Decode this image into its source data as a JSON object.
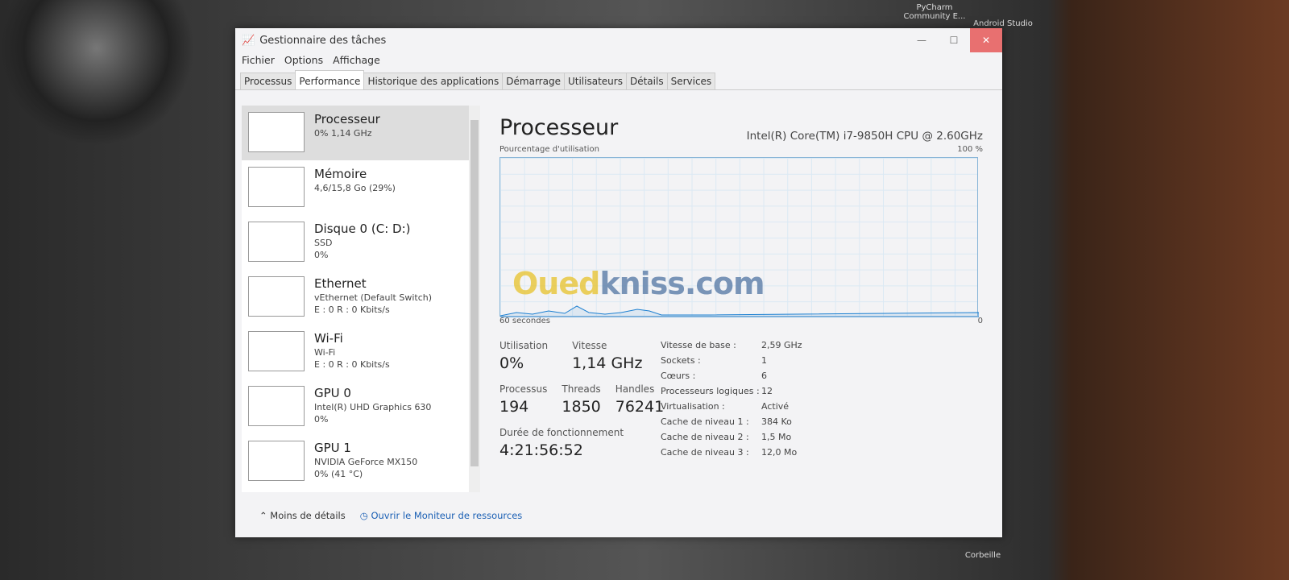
{
  "desktop": {
    "icons": [
      "PyCharm Community E...",
      "Android Studio",
      "Corbeille"
    ]
  },
  "window": {
    "title": "Gestionnaire des tâches",
    "controls": [
      "minimize",
      "maximize",
      "close"
    ]
  },
  "menu": [
    "Fichier",
    "Options",
    "Affichage"
  ],
  "tabs": [
    "Processus",
    "Performance",
    "Historique des applications",
    "Démarrage",
    "Utilisateurs",
    "Détails",
    "Services"
  ],
  "active_tab": "Performance",
  "sidebar": [
    {
      "name": "Processeur",
      "sub1": "0% 1,14 GHz",
      "sub2": ""
    },
    {
      "name": "Mémoire",
      "sub1": "4,6/15,8 Go (29%)",
      "sub2": ""
    },
    {
      "name": "Disque 0 (C: D:)",
      "sub1": "SSD",
      "sub2": "0%"
    },
    {
      "name": "Ethernet",
      "sub1": "vEthernet (Default Switch)",
      "sub2": "E : 0 R : 0 Kbits/s"
    },
    {
      "name": "Wi-Fi",
      "sub1": "Wi-Fi",
      "sub2": "E : 0 R : 0 Kbits/s"
    },
    {
      "name": "GPU 0",
      "sub1": "Intel(R) UHD Graphics 630",
      "sub2": "0%"
    },
    {
      "name": "GPU 1",
      "sub1": "NVIDIA GeForce MX150",
      "sub2": "0% (41 °C)"
    }
  ],
  "main": {
    "title": "Processeur",
    "model": "Intel(R) Core(TM) i7-9850H CPU @ 2.60GHz",
    "graph_label": "Pourcentage d'utilisation",
    "graph_max": "100 %",
    "graph_min": "0",
    "graph_time": "60 secondes",
    "utilisation_label": "Utilisation",
    "utilisation": "0%",
    "vitesse_label": "Vitesse",
    "vitesse": "1,14 GHz",
    "processus_label": "Processus",
    "processus": "194",
    "threads_label": "Threads",
    "threads": "1850",
    "handles_label": "Handles",
    "handles": "76241",
    "uptime_label": "Durée de fonctionnement",
    "uptime": "4:21:56:52",
    "specs": [
      [
        "Vitesse de base :",
        "2,59 GHz"
      ],
      [
        "Sockets :",
        "1"
      ],
      [
        "Cœurs :",
        "6"
      ],
      [
        "Processeurs logiques :",
        "12"
      ],
      [
        "Virtualisation :",
        "Activé"
      ],
      [
        "Cache de niveau 1 :",
        "384 Ko"
      ],
      [
        "Cache de niveau 2 :",
        "1,5 Mo"
      ],
      [
        "Cache de niveau 3 :",
        "12,0 Mo"
      ]
    ]
  },
  "footer": {
    "less": "Moins de détails",
    "monitor": "Ouvrir le Moniteur de ressources"
  },
  "watermark": "Ouedkniss.com",
  "colors": {
    "graph_line": "#1b7fd1",
    "graph_grid": "#dbe9f4"
  }
}
